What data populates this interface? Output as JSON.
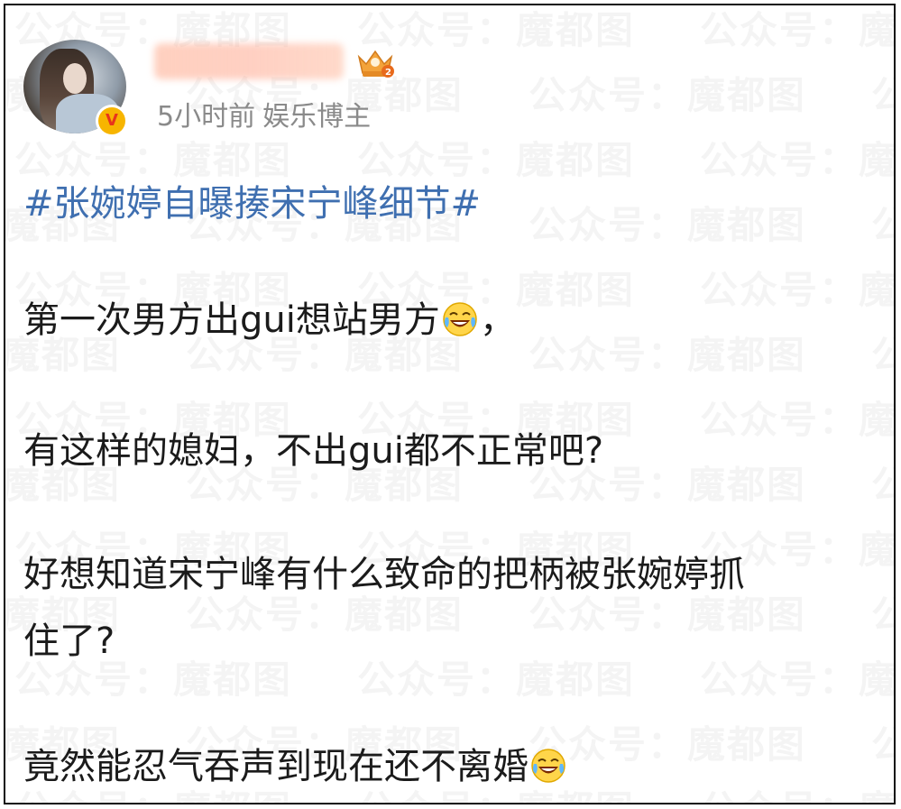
{
  "watermark": {
    "texts": [
      "公众号：魔都图",
      "魔都图",
      "公众号：",
      "众号："
    ]
  },
  "post": {
    "author": {
      "badge_letter": "V",
      "timestamp": "5小时前",
      "author_type": "娱乐博主"
    },
    "hashtag": "#张婉婷自曝揍宋宁峰细节#",
    "paragraphs": [
      {
        "text": "第一次男方出gui想站男方",
        "suffix": "，",
        "emoji": "laugh-cry-emoji"
      },
      {
        "text": "有这样的媳妇，不出gui都不正常吧?"
      },
      {
        "text": "好想知道宋宁峰有什么致命的把柄被张婉婷抓"
      },
      {
        "text": "住了?"
      },
      {
        "text": "竟然能忍气吞声到现在还不离婚",
        "emoji": "laugh-cry-emoji"
      }
    ]
  },
  "colors": {
    "hashtag": "#3f6fb0",
    "meta": "#8a8a8a",
    "body_text": "#1b1b1b",
    "verified_badge": "#f7b500",
    "verified_letter": "#e8341c",
    "emoji_face": "#ffd54a"
  }
}
